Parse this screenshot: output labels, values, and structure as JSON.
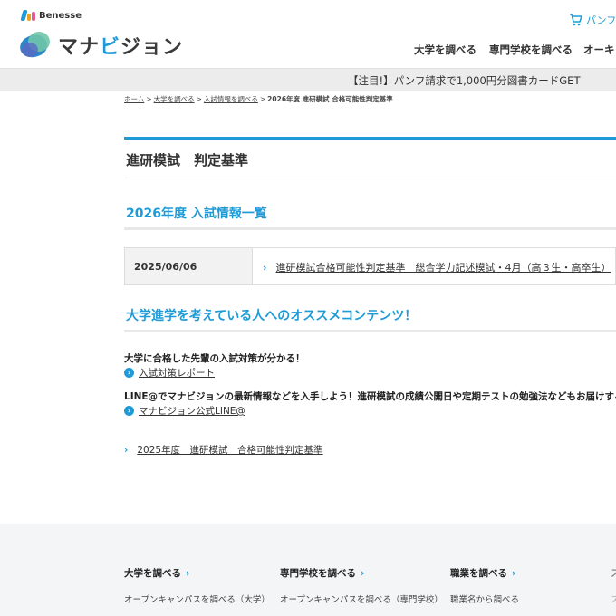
{
  "header": {
    "brand": "Benesse",
    "logo_prefix": "マナ",
    "logo_highlight": "ビ",
    "logo_suffix": "ジョン",
    "cart_label": "パンフ",
    "nav": [
      "大学を調べる",
      "専門学校を調べる",
      "オーキャ"
    ]
  },
  "banner": {
    "text": "【注目!】パンフ請求で1,000円分図書カードGET"
  },
  "breadcrumb": {
    "items": [
      "ホーム",
      "大学を調べる",
      "入試情報を調べる"
    ],
    "current": "2026年度 進研模試 合格可能性判定基準"
  },
  "page": {
    "title": "進研模試　判定基準",
    "section_info": "2026年度 入試情報一覧",
    "section_rec": "大学進学を考えている人へのオススメコンテンツ！"
  },
  "info_table": {
    "rows": [
      {
        "date": "2025/06/06",
        "link": "進研模試合格可能性判定基準　総合学力記述模試・4月（高３生・高卒生）"
      }
    ]
  },
  "recommend": [
    {
      "lead": "大学に合格した先輩の入試対策が分かる！",
      "link": "入試対策レポート"
    },
    {
      "lead": "LINE@でマナビジョンの最新情報などを入手しよう！進研模試の成績公開日や定期テストの勉強法などもお届けするよ",
      "link": "マナビジョン公式LINE@"
    }
  ],
  "prev_link": "2025年度　進研模試　合格可能性判定基準",
  "footer": {
    "cols": [
      {
        "heading": "大学を調べる",
        "link": "オープンキャンパスを調べる（大学）"
      },
      {
        "heading": "専門学校を調べる",
        "link": "オープンキャンパスを調べる（専門学校）"
      },
      {
        "heading": "職業を調べる",
        "link": "職業名から調べる"
      }
    ],
    "edge_heading": "ス",
    "edge_link": "ス"
  },
  "colors": {
    "accent": "#1e9bd7",
    "banner_bg": "#ececec",
    "footer_bg": "#f4f5f6"
  }
}
